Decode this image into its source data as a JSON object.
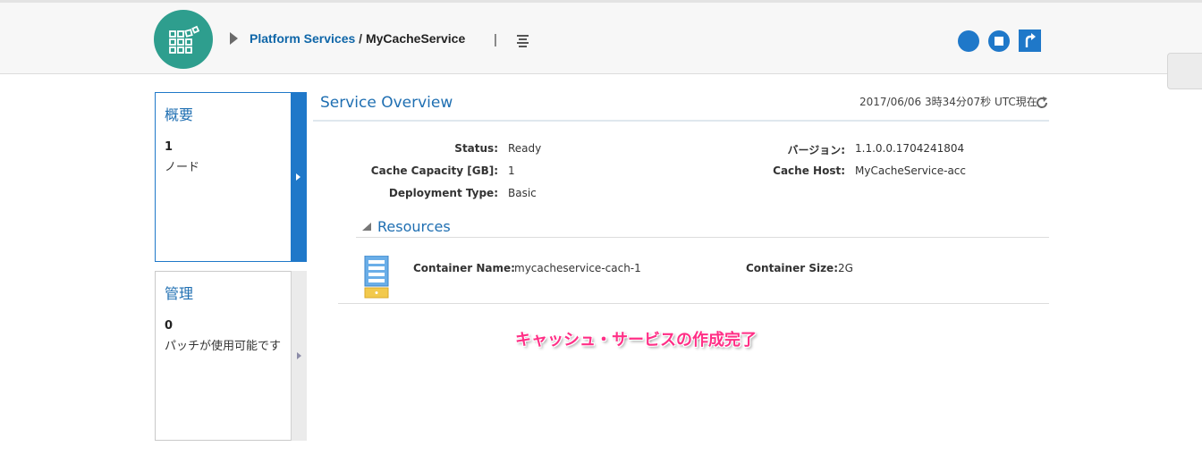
{
  "header": {
    "breadcrumb_link": "Platform Services",
    "breadcrumb_separator": " / ",
    "breadcrumb_current": "MyCacheService",
    "pipe": "|",
    "icons": {
      "logo": "platform-grid-icon",
      "breadcrumb_arrow": "triangle-right-icon",
      "menu": "hamburger-menu-icon",
      "start": "start-circle-icon",
      "stop": "stop-square-icon",
      "restart": "restart-arrow-icon"
    },
    "colors": {
      "accent": "#1f78c9",
      "logo_bg": "#2e9e8e"
    }
  },
  "sidebar": {
    "cards": [
      {
        "title": "概要",
        "count": "1",
        "description": "ノード",
        "active": true
      },
      {
        "title": "管理",
        "count": "0",
        "description": "パッチが使用可能です",
        "active": false
      }
    ]
  },
  "overview": {
    "title": "Service Overview",
    "timestamp": "2017/06/06 3時34分07秒 UTC現在",
    "refresh_icon": "refresh-icon",
    "left_fields": [
      {
        "label": "Status:",
        "value": "Ready"
      },
      {
        "label": "Cache Capacity [GB]:",
        "value": "1"
      },
      {
        "label": "Deployment Type:",
        "value": "Basic"
      }
    ],
    "right_fields": [
      {
        "label": "バージョン:",
        "value": "1.1.0.0.1704241804"
      },
      {
        "label": "Cache Host:",
        "value": "MyCacheService-acc"
      }
    ]
  },
  "resources": {
    "title": "Resources",
    "container_name_label": "Container Name:",
    "container_name": "mycacheservice-cach-1",
    "container_size_label": "Container Size:",
    "container_size": "2G",
    "icon": "server-container-icon"
  },
  "annotation": "キャッシュ・サービスの作成完了"
}
